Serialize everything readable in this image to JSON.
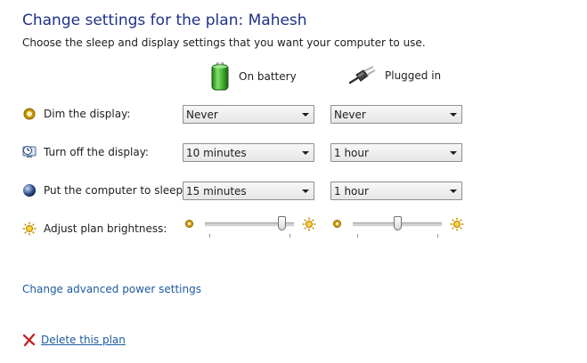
{
  "header": {
    "title": "Change settings for the plan: Mahesh",
    "description": "Choose the sleep and display settings that you want your computer to use."
  },
  "columns": {
    "battery_label": "On battery",
    "plugged_label": "Plugged in"
  },
  "settings": {
    "dim": {
      "label": "Dim the display:",
      "battery": "Never",
      "plugged": "Never"
    },
    "turn_off": {
      "label": "Turn off the display:",
      "battery": "10 minutes",
      "plugged": "1 hour"
    },
    "sleep": {
      "label": "Put the computer to sleep:",
      "battery": "15 minutes",
      "plugged": "1 hour"
    },
    "brightness": {
      "label": "Adjust plan brightness:",
      "battery_level": 0.9,
      "plugged_level": 0.5
    }
  },
  "links": {
    "advanced": "Change advanced power settings",
    "delete": "Delete this plan"
  },
  "colors": {
    "title": "#1e3287",
    "link": "#1e5aa0",
    "battery_green": "#3ca82c",
    "delete_red": "#c81e1e"
  },
  "icons": {
    "battery": "battery-icon",
    "plug": "plug-icon",
    "dim": "dim-display-icon",
    "turn_off": "clock-display-icon",
    "sleep": "moon-sleep-icon",
    "brightness": "sun-brightness-icon",
    "delete": "red-x-icon"
  }
}
